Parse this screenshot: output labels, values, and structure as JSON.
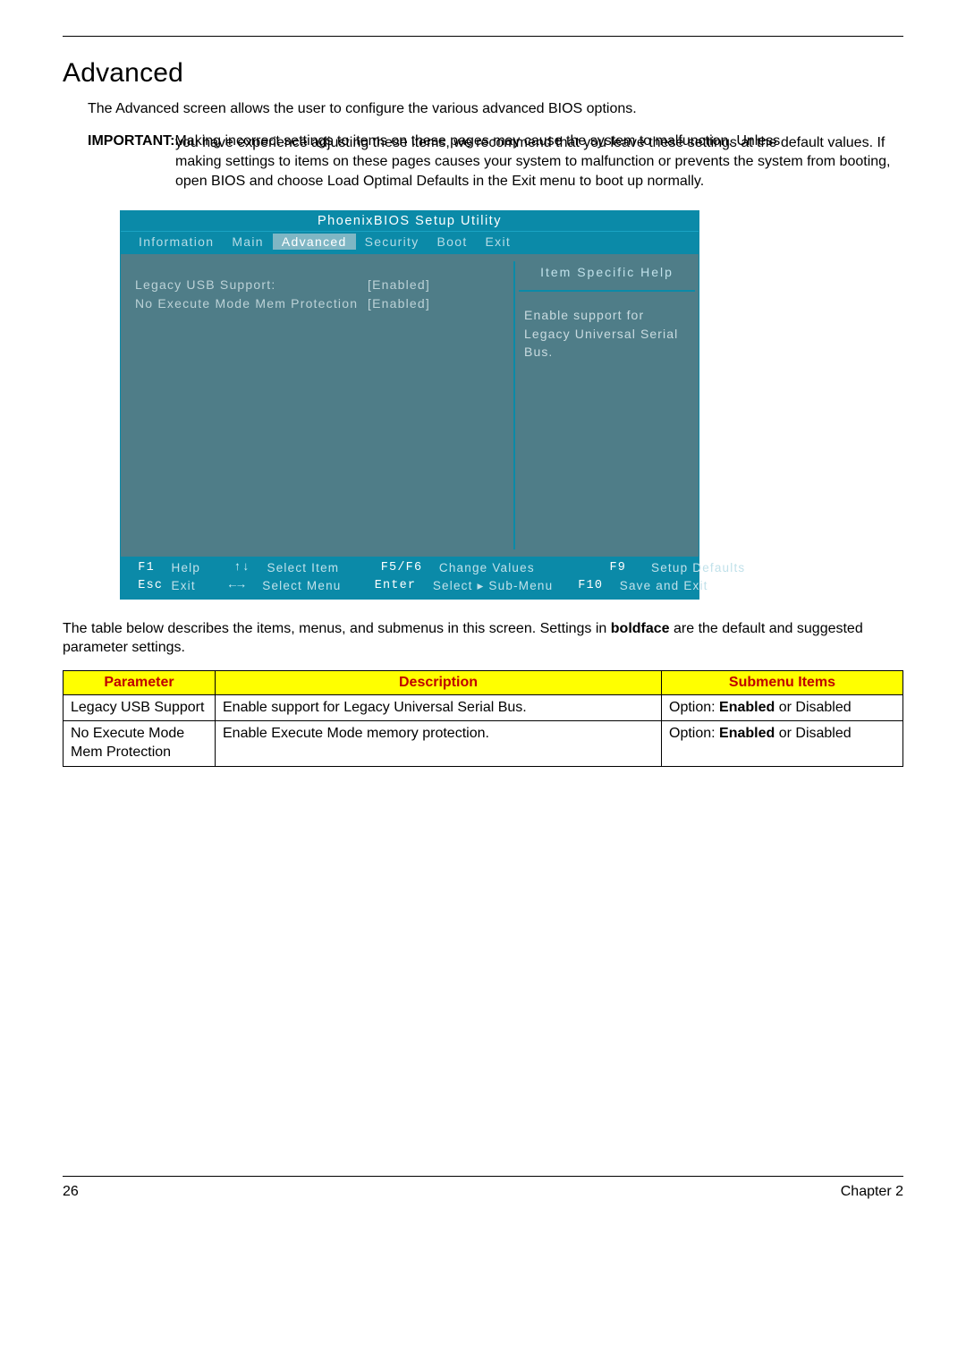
{
  "heading": "Advanced",
  "intro": "The Advanced screen allows the user to configure the various advanced BIOS options.",
  "important": {
    "label": "IMPORTANT:",
    "text": "Making incorrect settings to items on these pages may cause the system to malfunction. Unless you have experience adjusting these items, we recommend that you leave these settings at the default values. If making settings to items on these pages causes your system to malfunction or prevents the system from booting, open BIOS and choose Load Optimal Defaults in the Exit menu to boot up normally."
  },
  "bios": {
    "title": "PhoenixBIOS Setup Utility",
    "tabs": [
      "Information",
      "Main",
      "Advanced",
      "Security",
      "Boot",
      "Exit"
    ],
    "active_tab_index": 2,
    "settings": [
      {
        "label": "Legacy USB Support:",
        "value": "[Enabled]"
      },
      {
        "label": "No Execute Mode Mem Protection",
        "value": "[Enabled]"
      }
    ],
    "help": {
      "title": "Item Specific Help",
      "text": "Enable support for Legacy Universal Serial Bus."
    },
    "footer": {
      "r1c1_key": "F1",
      "r1c1_label": "Help",
      "r1c2_arrow": "↑↓",
      "r1c2_label": "Select Item",
      "r1c3_key": "F5/F6",
      "r1c3_label": "Change Values",
      "r1c4_key": "F9",
      "r1c4_label": "Setup Defaults",
      "r2c1_key": "Esc",
      "r2c1_label": "Exit",
      "r2c2_arrow": "←→",
      "r2c2_label": "Select Menu",
      "r2c3_key": "Enter",
      "r2c3_label": "Select ▸ Sub-Menu",
      "r2c4_key": "F10",
      "r2c4_label": "Save and Exit"
    }
  },
  "under_text_pre": "The table below describes the items, menus, and submenus in this screen. Settings in ",
  "under_text_bold": "boldface",
  "under_text_post": " are the default and suggested parameter settings.",
  "table": {
    "headers": {
      "param": "Parameter",
      "desc": "Description",
      "sub": "Submenu Items"
    },
    "rows": [
      {
        "param": "Legacy USB Support",
        "desc": "Enable support for Legacy Universal Serial Bus.",
        "opt_pre": "Option: ",
        "opt_bold": "Enabled",
        "opt_post": " or Disabled"
      },
      {
        "param": "No Execute Mode Mem Protection",
        "desc": "Enable Execute Mode memory protection.",
        "opt_pre": "Option: ",
        "opt_bold": "Enabled",
        "opt_post": " or Disabled"
      }
    ]
  },
  "footer": {
    "page": "26",
    "chapter": "Chapter 2"
  }
}
